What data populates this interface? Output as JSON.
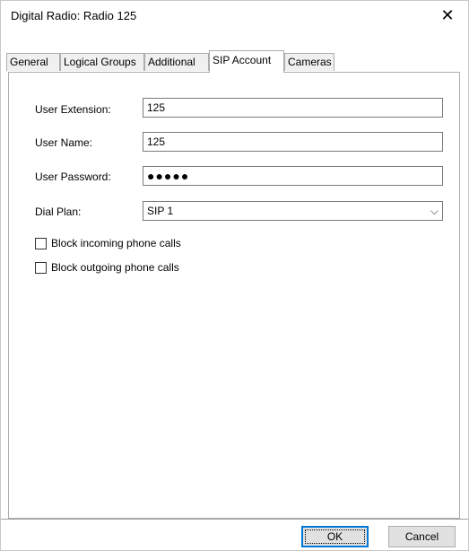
{
  "window": {
    "title": "Digital Radio: Radio 125",
    "close_glyph": "✕"
  },
  "tabs": [
    {
      "label": "General"
    },
    {
      "label": "Logical Groups"
    },
    {
      "label": "Additional"
    },
    {
      "label": "SIP Account"
    },
    {
      "label": "Cameras"
    }
  ],
  "form": {
    "user_extension": {
      "label": "User Extension:",
      "value": "125"
    },
    "user_name": {
      "label": "User Name:",
      "value": "125"
    },
    "user_password": {
      "label": "User Password:",
      "value": "●●●●●"
    },
    "dial_plan": {
      "label": "Dial Plan:",
      "value": "SIP 1",
      "arrow": "⌵"
    },
    "block_incoming": {
      "label": "Block incoming phone calls",
      "checked": false
    },
    "block_outgoing": {
      "label": "Block outgoing phone calls",
      "checked": false
    }
  },
  "buttons": {
    "ok": "OK",
    "cancel": "Cancel"
  },
  "colors": {
    "focus_border": "#0078d7",
    "button_bg": "#e1e1e1"
  }
}
